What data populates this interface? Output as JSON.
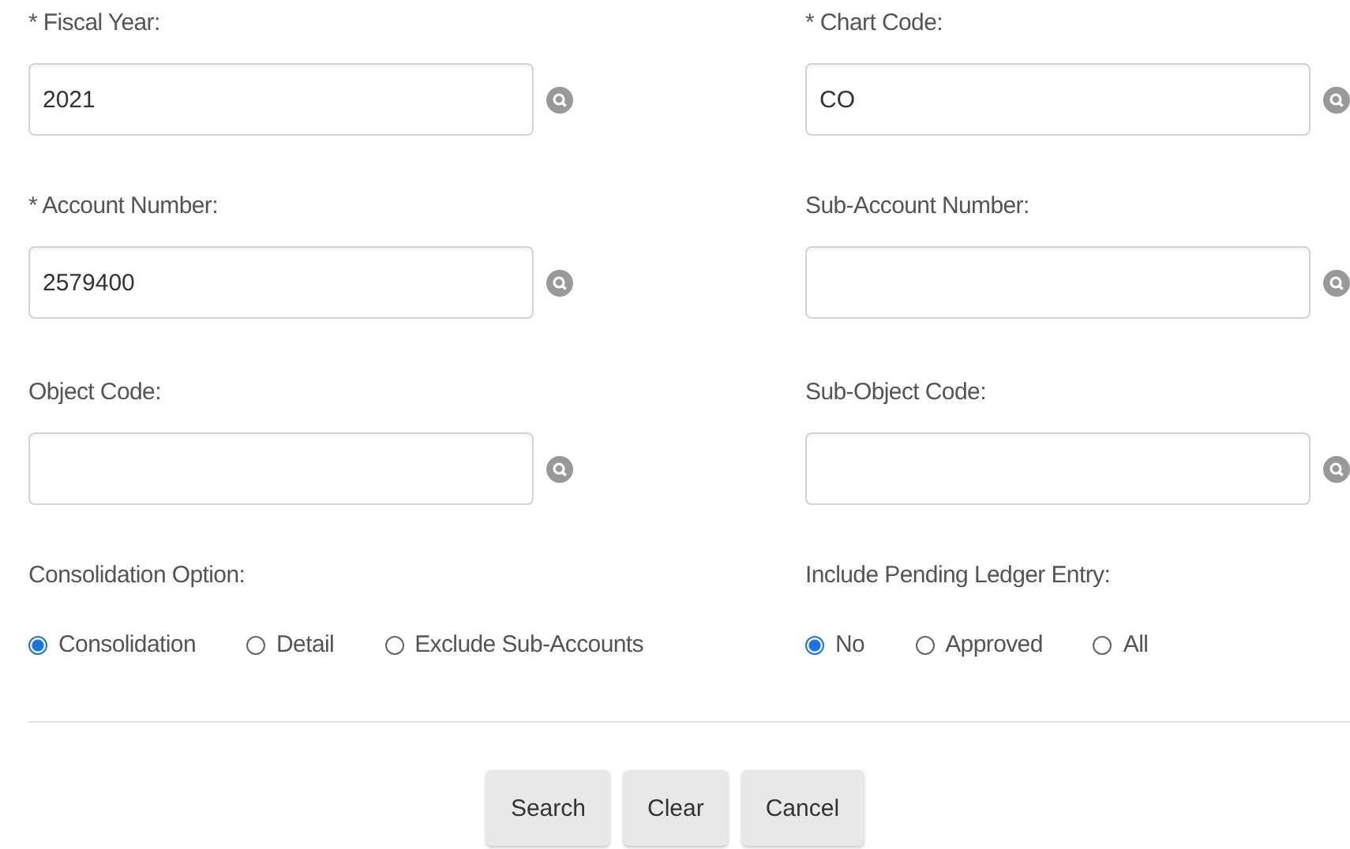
{
  "fields": [
    {
      "label": "* Fiscal Year:",
      "value": "2021"
    },
    {
      "label": "* Chart Code:",
      "value": "CO"
    },
    {
      "label": "* Account Number:",
      "value": "2579400"
    },
    {
      "label": "Sub-Account Number:"
    },
    {
      "label": "Object Code:"
    },
    {
      "label": "Sub-Object Code:"
    }
  ],
  "radio_groups": [
    {
      "label": "Consolidation Option:",
      "options": [
        {
          "label": "Consolidation",
          "selected": true
        },
        {
          "label": "Detail",
          "selected": false
        },
        {
          "label": "Exclude Sub-Accounts",
          "selected": false
        }
      ]
    },
    {
      "label": "Include Pending Ledger Entry:",
      "options": [
        {
          "label": "No",
          "selected": true
        },
        {
          "label": "Approved",
          "selected": false
        },
        {
          "label": "All",
          "selected": false
        }
      ]
    }
  ],
  "buttons": [
    "Search",
    "Clear",
    "Cancel"
  ]
}
